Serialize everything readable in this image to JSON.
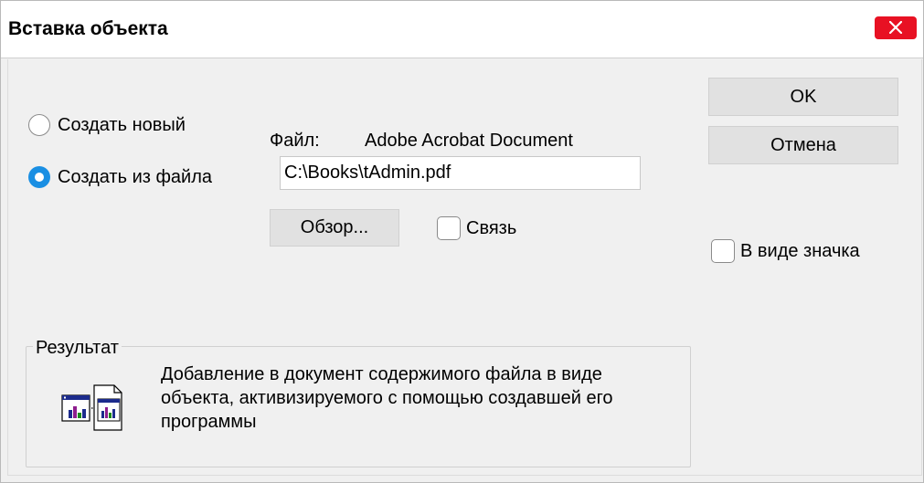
{
  "window": {
    "title": "Вставка объекта"
  },
  "options": {
    "create_new_label": "Создать новый",
    "create_from_file_label": "Создать из файла",
    "selected": "create_from_file"
  },
  "file": {
    "label": "Файл:",
    "type": "Adobe Acrobat Document",
    "path": "C:\\Books\\tAdmin.pdf"
  },
  "buttons": {
    "ok": "OK",
    "cancel": "Отмена",
    "browse": "Обзор..."
  },
  "checkboxes": {
    "link_label": "Связь",
    "link_checked": false,
    "as_icon_label": "В виде значка",
    "as_icon_checked": false
  },
  "result": {
    "caption": "Результат",
    "description": "Добавление в документ содержимого файла в виде объекта, активизируемого с помощью создавшей его программы",
    "icon": "embed-object-icon"
  },
  "colors": {
    "accent": "#1a8fe3",
    "close_button": "#e81123",
    "dialog_bg": "#f0f0f0"
  }
}
